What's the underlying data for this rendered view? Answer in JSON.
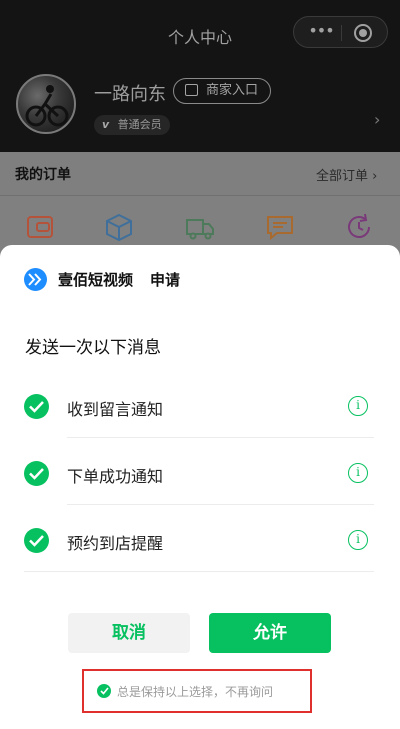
{
  "header": {
    "title": "个人中心"
  },
  "profile": {
    "username": "一路向东",
    "merchant_button": "商家入口",
    "member_badge_mark": "v",
    "member_level": "普通会员"
  },
  "orders": {
    "title": "我的订单",
    "view_all": "全部订单"
  },
  "sheet": {
    "app_name": "壹佰短视频",
    "action": "申请",
    "title": "发送一次以下消息",
    "options": [
      {
        "label": "收到留言通知",
        "checked": true
      },
      {
        "label": "下单成功通知",
        "checked": true
      },
      {
        "label": "预约到店提醒",
        "checked": true
      }
    ],
    "cancel_label": "取消",
    "allow_label": "允许",
    "remember_text": "总是保持以上选择，不再询问",
    "remember_checked": true
  },
  "colors": {
    "accent_green": "#07c160",
    "highlight_red": "#e0302e",
    "app_logo_blue": "#1e8dff"
  },
  "icons": {
    "capsule_more": "more-dots-icon",
    "capsule_close": "target-circle-icon",
    "orders": [
      "wallet-icon",
      "box-icon",
      "truck-icon",
      "message-icon",
      "refresh-icon"
    ]
  }
}
